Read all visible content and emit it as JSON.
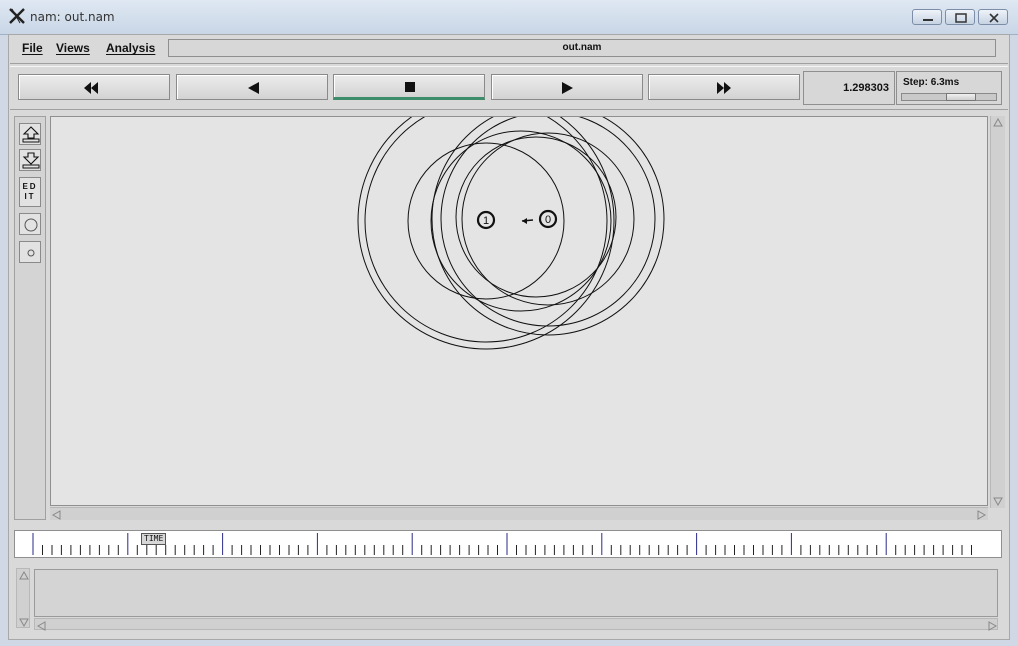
{
  "window": {
    "title": "nam: out.nam",
    "app_icon": "x-logo-icon",
    "controls": [
      "minimize-icon",
      "restore-icon",
      "close-icon"
    ]
  },
  "menu": {
    "file": "File",
    "views": "Views",
    "analysis": "Analysis",
    "file_title": "out.nam"
  },
  "playback": {
    "buttons": [
      {
        "name": "fast-rewind",
        "icon": "fast-rewind-icon"
      },
      {
        "name": "rewind",
        "icon": "rewind-icon"
      },
      {
        "name": "stop",
        "icon": "stop-icon",
        "active": true
      },
      {
        "name": "play",
        "icon": "play-icon"
      },
      {
        "name": "fast-forward",
        "icon": "fast-forward-icon"
      }
    ],
    "current_time": "1.298303",
    "step_label": "Step: 6.3ms"
  },
  "toolbar": {
    "tools": [
      "zoom-in-icon",
      "zoom-out-icon",
      "edit-button",
      "large-node-icon",
      "small-node-icon"
    ],
    "edit_label": "ED IT"
  },
  "network": {
    "nodes": [
      {
        "id": "1",
        "label": "1"
      },
      {
        "id": "0",
        "label": "0"
      }
    ],
    "packet_direction": "0 to 1"
  },
  "timeline": {
    "marker_label": "TIME"
  },
  "colors": {
    "active_indicator": "#3d8c6a",
    "canvas_bg": "#e4e4e4",
    "timeline_major_tick": "#2a2a8a"
  }
}
